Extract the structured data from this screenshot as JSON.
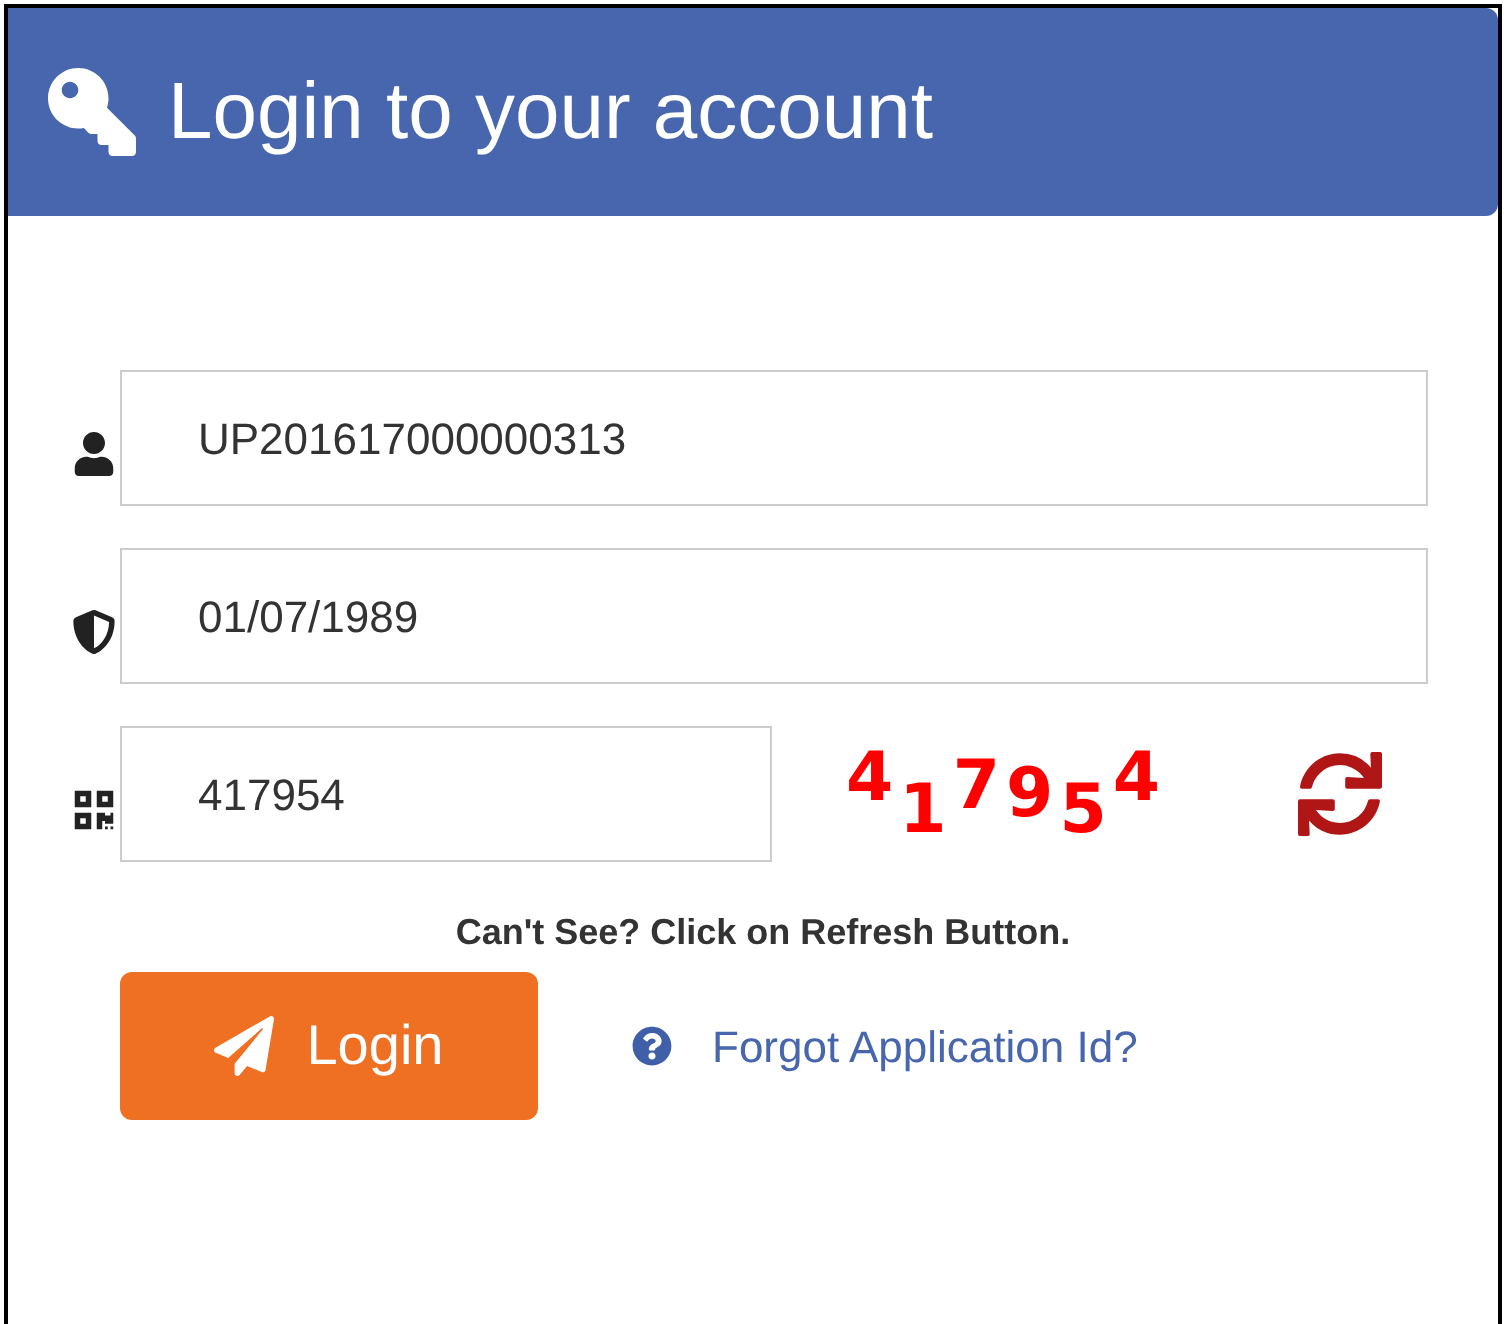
{
  "header": {
    "title": "Login to your account"
  },
  "fields": [
    {
      "kind": "user",
      "value": "UP201617000000313"
    },
    {
      "kind": "password",
      "value": "01/07/1989"
    },
    {
      "kind": "captcha",
      "value": "417954"
    }
  ],
  "captcha": {
    "text": "417954"
  },
  "hint": "Can't See? Click on Refresh Button.",
  "login_button": "Login",
  "forgot_link": "Forgot Application Id?"
}
